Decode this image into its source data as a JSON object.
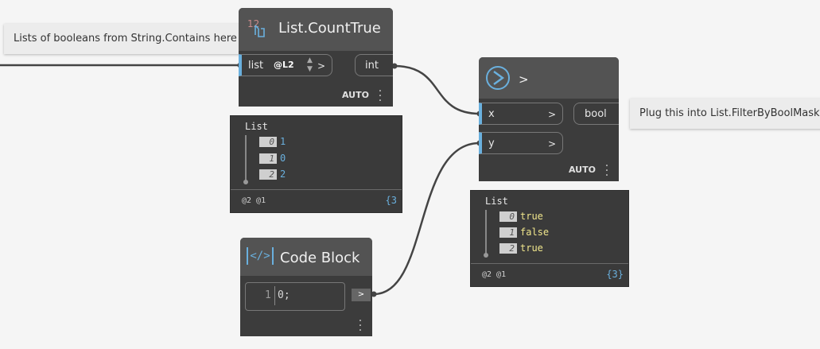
{
  "notes": {
    "left": "Lists of booleans from String.Contains here",
    "right": "Plug this into List.FilterByBoolMask"
  },
  "count_node": {
    "icon": "list-count-icon",
    "title": "List.CountTrue",
    "input_label": "list",
    "lacing_value": "@L2",
    "arrow": ">",
    "output_label": "int",
    "run_mode": "AUTO",
    "watch": {
      "title": "List",
      "items": [
        {
          "index": "0",
          "value": "1"
        },
        {
          "index": "1",
          "value": "0"
        },
        {
          "index": "2",
          "value": "2"
        }
      ],
      "levels": "@2 @1",
      "count": "{3"
    }
  },
  "compare_node": {
    "icon": "greater-than-icon",
    "title": ">",
    "inputs": [
      {
        "label": "x",
        "arrow": ">"
      },
      {
        "label": "y",
        "arrow": ">"
      }
    ],
    "output_label": "bool",
    "run_mode": "AUTO",
    "watch": {
      "title": "List",
      "items": [
        {
          "index": "0",
          "value": "true"
        },
        {
          "index": "1",
          "value": "false"
        },
        {
          "index": "2",
          "value": "true"
        }
      ],
      "levels": "@2 @1",
      "count": "{3}"
    }
  },
  "code_node": {
    "icon": "code-block-icon",
    "icon_text": "</>",
    "title": "Code Block",
    "line_number": "1",
    "code": "0;",
    "output_arrow": ">"
  },
  "colors": {
    "canvas": "#f5f5f5",
    "node_body": "#3c3c3c",
    "node_header": "#535353",
    "accent": "#6ab0de",
    "bool_value": "#f0e68c"
  }
}
